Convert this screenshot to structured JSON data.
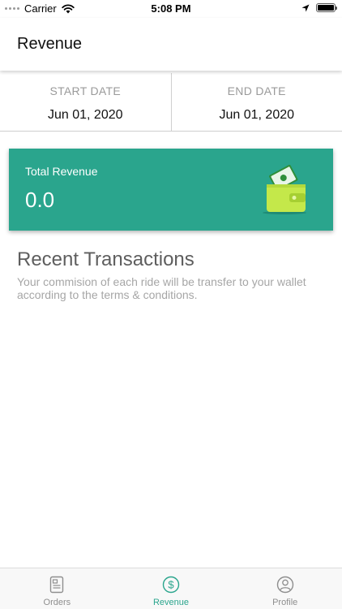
{
  "status_bar": {
    "carrier": "Carrier",
    "time": "5:08 PM",
    "icons": [
      "signal-dots-icon",
      "wifi-icon",
      "location-arrow-icon",
      "battery-icon"
    ]
  },
  "header": {
    "title": "Revenue"
  },
  "date_range": {
    "start_label": "START DATE",
    "start_value": "Jun 01, 2020",
    "end_label": "END DATE",
    "end_value": "Jun 01, 2020"
  },
  "revenue_card": {
    "label": "Total Revenue",
    "value": "0.0",
    "icon": "wallet-icon",
    "background_color": "#2aa58d",
    "wallet_color": "#c4e84a"
  },
  "transactions": {
    "title": "Recent Transactions",
    "description": "Your commision of each ride will be transfer to your wallet according to the terms & conditions."
  },
  "tab_bar": {
    "tabs": [
      {
        "label": "Orders",
        "icon": "document-icon",
        "active": false
      },
      {
        "label": "Revenue",
        "icon": "dollar-circle-icon",
        "active": true
      },
      {
        "label": "Profile",
        "icon": "user-circle-icon",
        "active": false
      }
    ],
    "active_color": "#2aa58d",
    "inactive_color": "#8e8e8e"
  }
}
